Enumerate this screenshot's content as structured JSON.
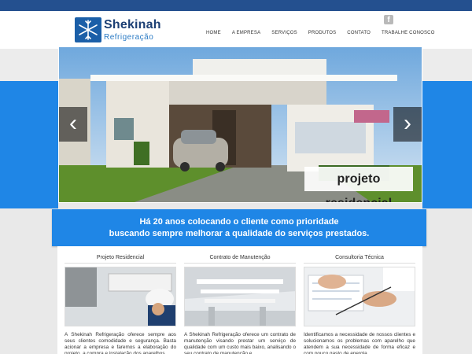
{
  "brand": {
    "name": "Shekinah",
    "sub": "Refrigeração"
  },
  "social": {
    "facebook_glyph": "f"
  },
  "nav": [
    "HOME",
    "A EMPRESA",
    "SERVIÇOS",
    "PRODUTOS",
    "CONTATO",
    "TRABALHE CONOSCO"
  ],
  "slider": {
    "caption": "projeto residencial",
    "prev": "‹",
    "next": "›"
  },
  "banner": {
    "line1": "Há 20 anos colocando o cliente como prioridade",
    "line2": "buscando sempre melhorar a qualidade do serviços prestados."
  },
  "cards": [
    {
      "title": "Projeto Residencial",
      "text": "A Shekinah Refrigeração oferece sempre aos seus clientes comodidade e segurança. Basta acionar a empresa e faremos a elaboração do projeto, a compra e instalação dos aparelhos"
    },
    {
      "title": "Contrato de Manutenção",
      "text": "A Shekinah Refrigeração oferece um contrato de manutenção visando prestar um serviço de qualidade com um custo mais baixo, analisando o seu contrato de manutenção e"
    },
    {
      "title": "Consultoria Técnica",
      "text": "Identificamos a necessidade de nossos clientes e solucionamos os problemas com aparelho que atendem a sua necessidade de forma eficaz e com pouco gasto de energia."
    }
  ],
  "colors": {
    "topbar": "#24508f",
    "accent": "#1f86e6",
    "brand": "#1c3f74"
  }
}
